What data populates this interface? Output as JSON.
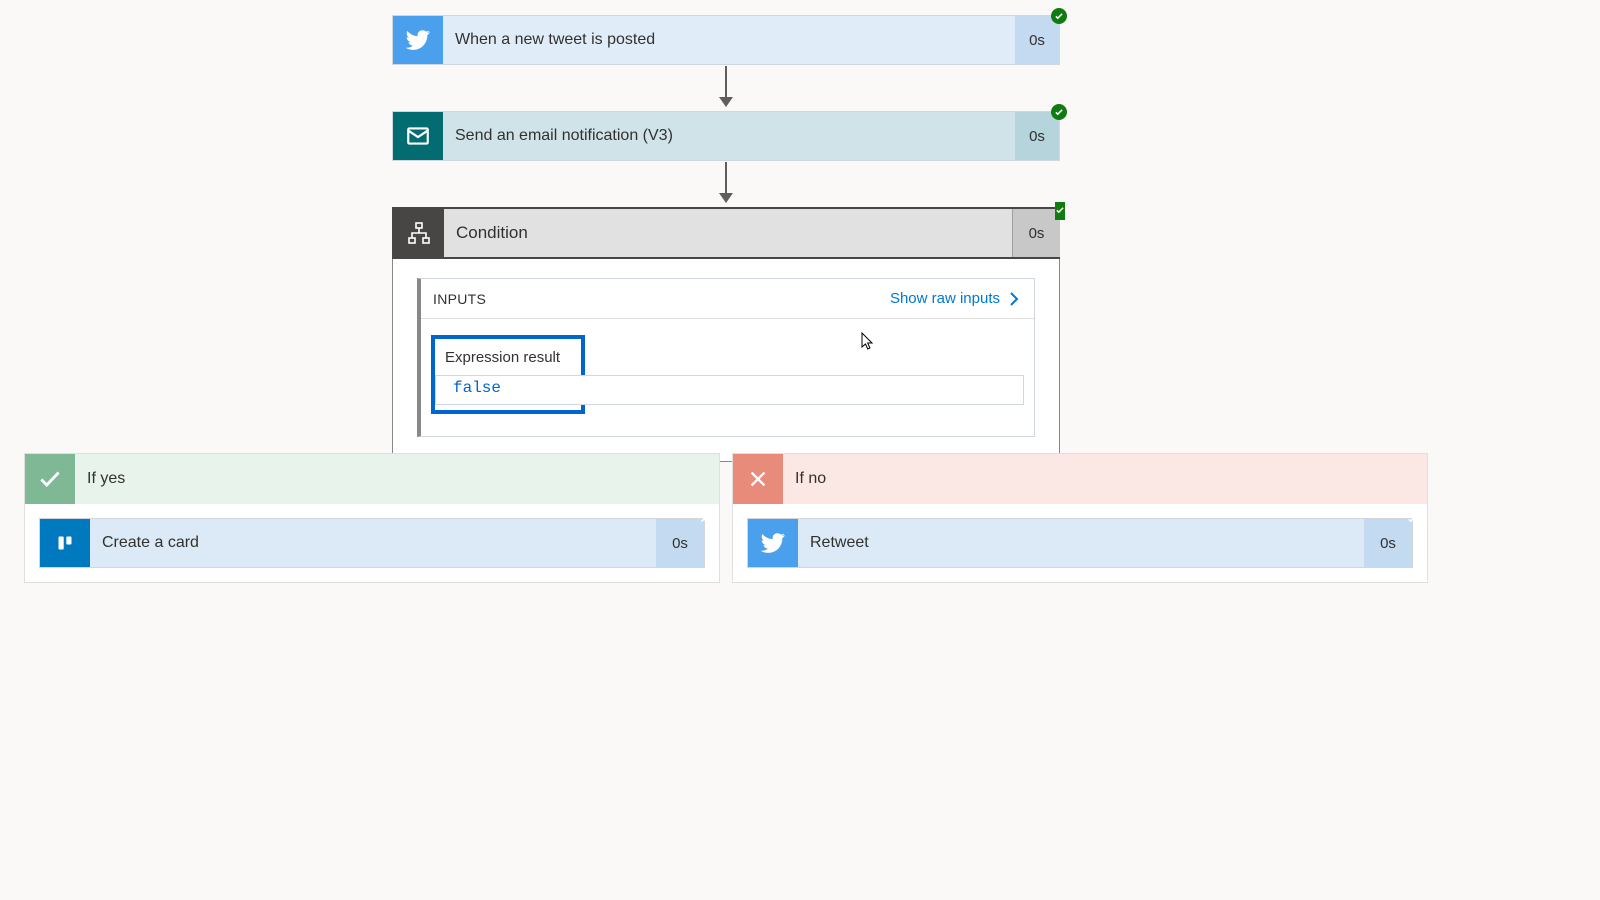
{
  "steps": {
    "trigger": {
      "label": "When a new tweet is posted",
      "time": "0s"
    },
    "email": {
      "label": "Send an email notification (V3)",
      "time": "0s"
    },
    "condition": {
      "label": "Condition",
      "time": "0s"
    }
  },
  "condition_panel": {
    "inputs_title": "INPUTS",
    "raw_link": "Show raw inputs",
    "expression_label": "Expression result",
    "expression_value": "false"
  },
  "branches": {
    "yes": {
      "label": "If yes",
      "action": {
        "label": "Create a card",
        "time": "0s"
      }
    },
    "no": {
      "label": "If no",
      "action": {
        "label": "Retweet",
        "time": "0s"
      }
    }
  }
}
